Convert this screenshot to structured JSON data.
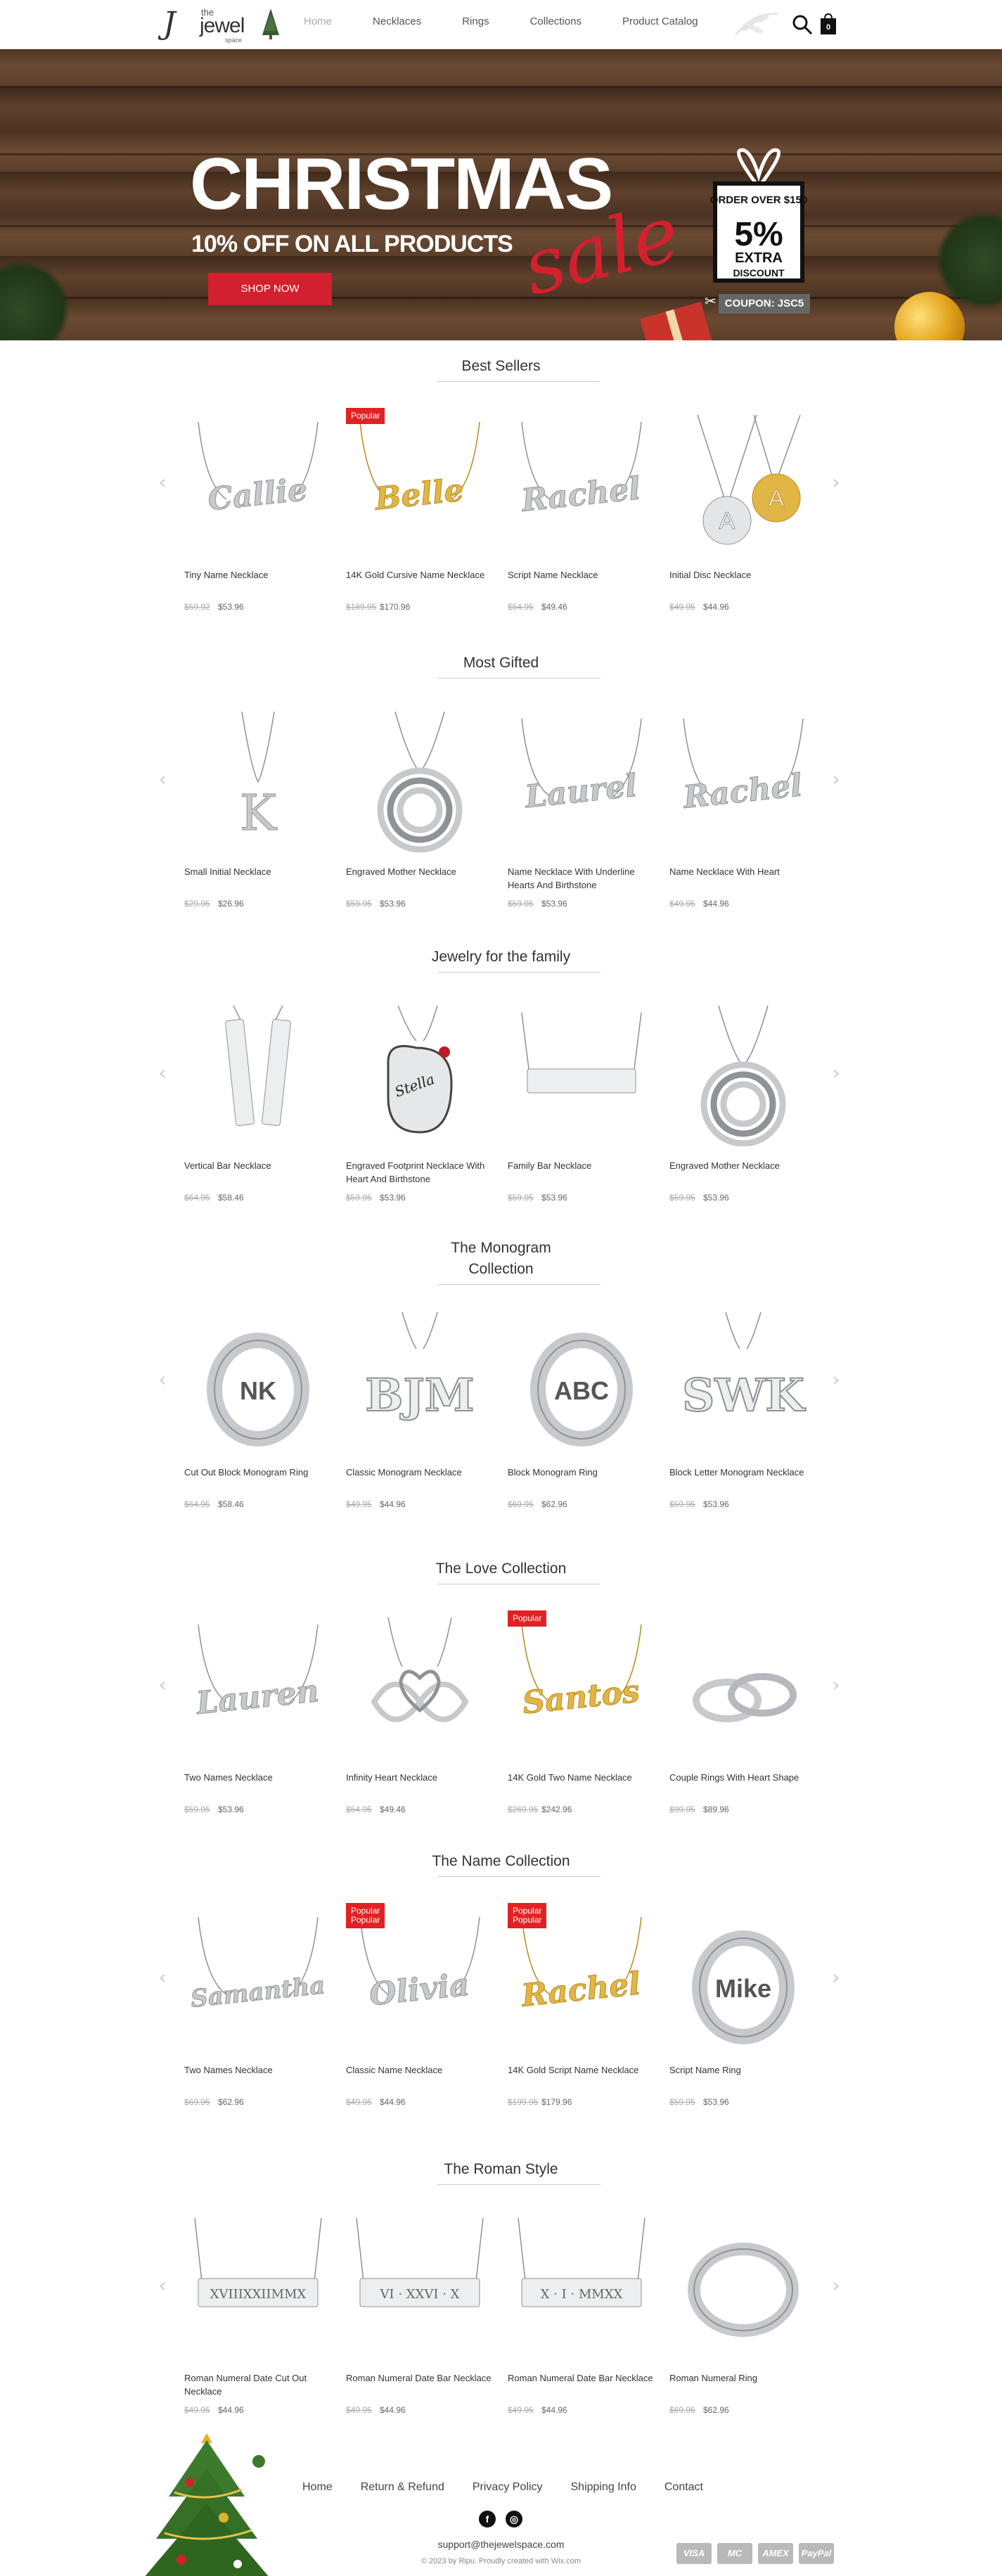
{
  "header": {
    "logo": {
      "mark": "J",
      "the": "the",
      "jewel": "jewel",
      "space": "space"
    },
    "nav": [
      "Home",
      "Necklaces",
      "Rings",
      "Collections",
      "Product Catalog"
    ],
    "active_nav": "Home",
    "cart_count": "0"
  },
  "banner": {
    "title": "CHRISTMAS",
    "subtitle": "10% OFF ON ALL PRODUCTS",
    "script": "sale",
    "button": "SHOP NOW",
    "gift": {
      "line1": "ORDER OVER $150",
      "line2": "5%",
      "line3": "EXTRA",
      "line4": "DISCOUNT",
      "coupon": "COUPON: JSC5"
    }
  },
  "sections": [
    {
      "title": "Best Sellers",
      "products": [
        {
          "name": "Tiny Name Necklace",
          "old": "$59.92",
          "price": "$53.96",
          "badge": "",
          "kind": "name",
          "metal": "silver",
          "text": "Callie"
        },
        {
          "name": "14K Gold Cursive Name Necklace",
          "old": "$189.95",
          "price": "$170.96",
          "badge": "Popular",
          "kind": "name",
          "metal": "gold",
          "text": "Belle"
        },
        {
          "name": "Script Name Necklace",
          "old": "$54.95",
          "price": "$49.46",
          "badge": "",
          "kind": "name",
          "metal": "silver",
          "text": "Rachel"
        },
        {
          "name": "Initial Disc Necklace",
          "old": "$49.95",
          "price": "$44.96",
          "badge": "",
          "kind": "discs",
          "metal": "silver",
          "text": "A"
        }
      ]
    },
    {
      "title": "Most Gifted",
      "products": [
        {
          "name": "Small Initial Necklace",
          "old": "$29.95",
          "price": "$26.96",
          "badge": "",
          "kind": "initial",
          "metal": "silver",
          "text": "K"
        },
        {
          "name": "Engraved Mother Necklace",
          "old": "$59.95",
          "price": "$53.96",
          "badge": "",
          "kind": "rings3",
          "metal": "silver",
          "text": ""
        },
        {
          "name": "Name Necklace With Underline Hearts And Birthstone",
          "old": "$59.95",
          "price": "$53.96",
          "badge": "",
          "kind": "name",
          "metal": "silver",
          "text": "Laurel"
        },
        {
          "name": "Name Necklace With Heart",
          "old": "$49.95",
          "price": "$44.96",
          "badge": "",
          "kind": "name",
          "metal": "silver",
          "text": "Rachel"
        }
      ]
    },
    {
      "title": "Jewelry for the family",
      "products": [
        {
          "name": "Vertical Bar Necklace",
          "old": "$64.95",
          "price": "$58.46",
          "badge": "",
          "kind": "vbars",
          "metal": "silver",
          "text": ""
        },
        {
          "name": "Engraved Footprint Necklace With Heart And Birthstone",
          "old": "$59.95",
          "price": "$53.96",
          "badge": "",
          "kind": "footprint",
          "metal": "silver",
          "text": "Stella"
        },
        {
          "name": "Family Bar Necklace",
          "old": "$59.95",
          "price": "$53.96",
          "badge": "",
          "kind": "bar",
          "metal": "silver",
          "text": ""
        },
        {
          "name": "Engraved Mother Necklace",
          "old": "$59.95",
          "price": "$53.96",
          "badge": "",
          "kind": "rings3",
          "metal": "silver",
          "text": ""
        }
      ]
    },
    {
      "title": "The Monogram\nCollection",
      "products": [
        {
          "name": "Cut Out Block Monogram Ring",
          "old": "$64.95",
          "price": "$58.46",
          "badge": "",
          "kind": "ring",
          "metal": "silver",
          "text": "NK"
        },
        {
          "name": "Classic Monogram Necklace",
          "old": "$49.95",
          "price": "$44.96",
          "badge": "",
          "kind": "monogram",
          "metal": "silver",
          "text": "BJM"
        },
        {
          "name": "Block Monogram Ring",
          "old": "$69.95",
          "price": "$62.96",
          "badge": "",
          "kind": "ring",
          "metal": "silver",
          "text": "ABC"
        },
        {
          "name": "Block Letter Monogram Necklace",
          "old": "$59.95",
          "price": "$53.96",
          "badge": "",
          "kind": "monogram",
          "metal": "silver",
          "text": "SWK"
        }
      ]
    },
    {
      "title": "The Love Collection",
      "products": [
        {
          "name": "Two Names Necklace",
          "old": "$59.95",
          "price": "$53.96",
          "badge": "",
          "kind": "name",
          "metal": "silver",
          "text": "Lauren"
        },
        {
          "name": "Infinity Heart Necklace",
          "old": "$54.95",
          "price": "$49.46",
          "badge": "",
          "kind": "infinity",
          "metal": "silver",
          "text": ""
        },
        {
          "name": "14K Gold Two Name Necklace",
          "old": "$269.95",
          "price": "$242.96",
          "badge": "Popular",
          "kind": "name",
          "metal": "gold",
          "text": "Santos"
        },
        {
          "name": "Couple Rings With Heart Shape",
          "old": "$99.95",
          "price": "$89.96",
          "badge": "",
          "kind": "couple",
          "metal": "silver",
          "text": ""
        }
      ]
    },
    {
      "title": "The Name Collection",
      "products": [
        {
          "name": "Two Names Necklace",
          "old": "$69.95",
          "price": "$62.96",
          "badge": "",
          "kind": "name",
          "metal": "silver",
          "text": "Samantha"
        },
        {
          "name": "Classic Name Necklace",
          "old": "$49.95",
          "price": "$44.96",
          "badge": "Popular\nPopular",
          "kind": "name",
          "metal": "silver",
          "text": "Olivia"
        },
        {
          "name": "14K Gold Script Name Necklace",
          "old": "$199.95",
          "price": "$179.96",
          "badge": "Popular\nPopular",
          "kind": "name",
          "metal": "gold",
          "text": "Rachel"
        },
        {
          "name": "Script Name Ring",
          "old": "$59.95",
          "price": "$53.96",
          "badge": "",
          "kind": "ring",
          "metal": "silver",
          "text": "Mike"
        }
      ]
    },
    {
      "title": "The Roman Style",
      "products": [
        {
          "name": "Roman Numeral Date Cut Out Necklace",
          "old": "$49.95",
          "price": "$44.96",
          "badge": "",
          "kind": "roman",
          "metal": "silver",
          "text": "XVIIIXXIIMMX"
        },
        {
          "name": "Roman Numeral Date Bar Necklace",
          "old": "$49.95",
          "price": "$44.96",
          "badge": "",
          "kind": "roman",
          "metal": "silver",
          "text": "VI · XXVI · X"
        },
        {
          "name": "Roman Numeral Date Bar Necklace",
          "old": "$49.95",
          "price": "$44.96",
          "badge": "",
          "kind": "roman",
          "metal": "silver",
          "text": "X · I · MMXX"
        },
        {
          "name": "Roman Numeral Ring",
          "old": "$69.95",
          "price": "$62.96",
          "badge": "",
          "kind": "romanring",
          "metal": "silver",
          "text": ""
        }
      ]
    }
  ],
  "footer": {
    "links": [
      "Home",
      "Return & Refund",
      "Privacy Policy",
      "Shipping Info",
      "Contact"
    ],
    "social": [
      "f",
      "◎"
    ],
    "email": "support@thejewelspace.com",
    "copyright": "© 2023 by Ripu. Proudly created with Wix.com",
    "payments": [
      "VISA",
      "MC",
      "AMEX",
      "PayPal"
    ]
  },
  "colors": {
    "accent": "#d3202e",
    "badge": "#e12224",
    "text": "#333333",
    "silver": "#c7c9cc",
    "gold": "#e2b646"
  }
}
